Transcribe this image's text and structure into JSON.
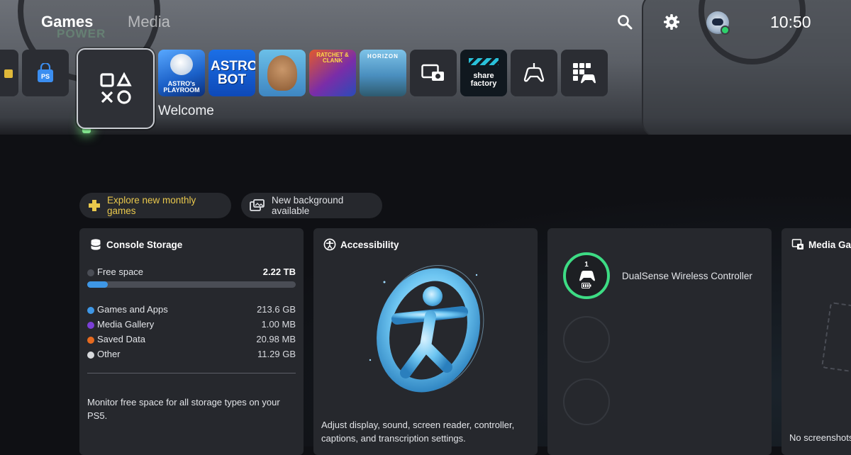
{
  "nav": {
    "tabs": [
      {
        "label": "Games",
        "active": true
      },
      {
        "label": "Media",
        "active": false
      }
    ],
    "icons": [
      "search-icon",
      "gear-icon",
      "avatar"
    ],
    "clock": "10:50"
  },
  "background": {
    "labels": [
      "POWER"
    ]
  },
  "tiles": {
    "items": [
      {
        "name": "store-partial",
        "label": ""
      },
      {
        "name": "playstation-store",
        "label": ""
      },
      {
        "name": "game-library",
        "label": ""
      },
      {
        "name": "astros-playroom",
        "label": "ASTRO's PLAYROOM"
      },
      {
        "name": "astro-bot",
        "label": "ASTRO BOT"
      },
      {
        "name": "sackboy",
        "label": ""
      },
      {
        "name": "ratchet-clank",
        "label": "RATCHET & CLANK"
      },
      {
        "name": "horizon",
        "label": "HORIZON"
      },
      {
        "name": "media-gallery-app",
        "label": ""
      },
      {
        "name": "share-factory",
        "label": "share factory"
      },
      {
        "name": "game-base",
        "label": ""
      },
      {
        "name": "all-apps",
        "label": ""
      }
    ],
    "selected_caption": "Welcome"
  },
  "pills": {
    "plus_label": "Explore new monthly games",
    "background_label": "New background available"
  },
  "storage_card": {
    "title": "Console Storage",
    "free_space_label": "Free space",
    "free_space_value": "2.22 TB",
    "used_fraction": 0.1,
    "rows": [
      {
        "label": "Games and Apps",
        "value": "213.6 GB",
        "color": "#3e97e6"
      },
      {
        "label": "Media Gallery",
        "value": "1.00 MB",
        "color": "#7b3fd6"
      },
      {
        "label": "Saved Data",
        "value": "20.98 MB",
        "color": "#e66a1f"
      },
      {
        "label": "Other",
        "value": "11.29 GB",
        "color": "#d8dadd"
      }
    ],
    "description": "Monitor free space for all storage types on your PS5."
  },
  "accessibility_card": {
    "title": "Accessibility",
    "description": "Adjust display, sound, screen reader, controller, captions, and transcription settings."
  },
  "controller_card": {
    "controller_number": "1",
    "controller_name": "DualSense Wireless Controller"
  },
  "media_card": {
    "title": "Media Gal",
    "description": "No screenshots"
  },
  "colors": {
    "accent_green": "#3ddc84",
    "plus_yellow": "#e9c84c",
    "storage_blue": "#3e97e6"
  }
}
